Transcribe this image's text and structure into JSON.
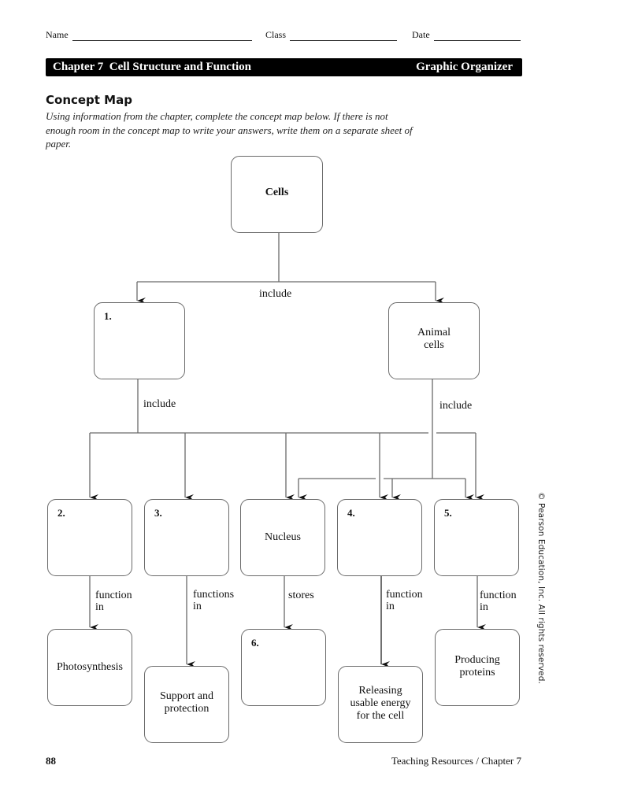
{
  "header": {
    "name_label": "Name",
    "class_label": "Class",
    "date_label": "Date",
    "chapter_title": "Chapter 7  Cell Structure and Function",
    "section_type": "Graphic Organizer"
  },
  "section": {
    "title": "Concept Map",
    "instructions": "Using information from the chapter, complete the concept map below. If there is not enough room in the concept map to write your answers, write them on a separate sheet of paper."
  },
  "concept_map": {
    "nodes": {
      "cells": {
        "text": "Cells"
      },
      "blank1": {
        "number": "1.",
        "text": ""
      },
      "animal_cells": {
        "text": "Animal cells"
      },
      "blank2": {
        "number": "2.",
        "text": ""
      },
      "blank3": {
        "number": "3.",
        "text": ""
      },
      "nucleus": {
        "text": "Nucleus"
      },
      "blank4": {
        "number": "4.",
        "text": ""
      },
      "blank5": {
        "number": "5.",
        "text": ""
      },
      "photosynthesis": {
        "text": "Photosynthesis"
      },
      "support": {
        "text": "Support and protection"
      },
      "blank6": {
        "number": "6.",
        "text": ""
      },
      "releasing": {
        "text": "Releasing usable energy for the cell"
      },
      "producing": {
        "text": "Producing proteins"
      }
    },
    "links": {
      "cells_include": "include",
      "plant_include": "include",
      "animal_include": "include",
      "b2_function": "function in",
      "b3_function": "functions in",
      "nucleus_stores": "stores",
      "b4_function": "function in",
      "b5_function": "function in"
    }
  },
  "sidebar": {
    "copyright": "© Pearson Education, Inc. All rights reserved."
  },
  "footer": {
    "page_number": "88",
    "source": "Teaching Resources / Chapter 7"
  }
}
